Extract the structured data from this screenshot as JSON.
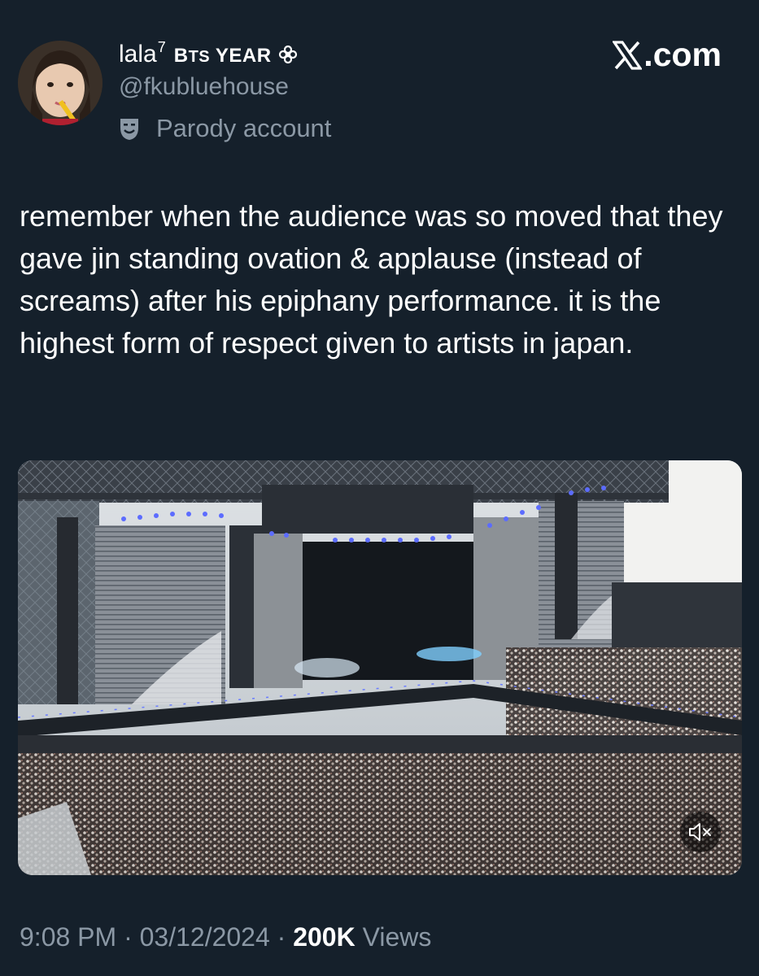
{
  "author": {
    "name": "lala",
    "name_sup": "7",
    "name_tag_b": "B",
    "name_tag_ts": "TS",
    "name_tag_year": " YEAR",
    "handle": "@fkubluehouse",
    "label": "Parody account",
    "avatar_icon": "avatar-photo"
  },
  "brand": {
    "site": ".com",
    "logo_icon": "x-logo"
  },
  "tweet": {
    "text": "remember when the audience was so moved that they gave jin standing ovation & applause (instead of screams) after his epiphany performance. it is the highest form of respect given to artists in japan."
  },
  "media": {
    "type": "video",
    "mute_icon": "muted-speaker-icon"
  },
  "meta": {
    "time": "9:08 PM",
    "sep1": " · ",
    "date": "03/12/2024",
    "sep2": " · ",
    "views_count": "200K",
    "views_label": " Views"
  },
  "colors": {
    "background": "#15202b",
    "text_primary": "#ffffff",
    "text_secondary": "#8b98a5"
  }
}
